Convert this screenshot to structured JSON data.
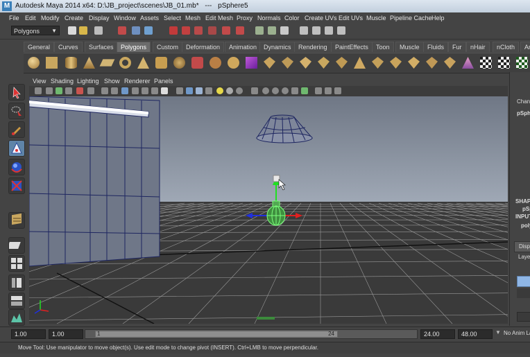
{
  "window": {
    "app_title": "Autodesk Maya 2014 x64: D:\\JB_project\\scenes\\JB_01.mb*",
    "separator": "---",
    "selection": "pSphere5"
  },
  "menubar": [
    "File",
    "Edit",
    "Modify",
    "Create",
    "Display",
    "Window",
    "Assets",
    "Select",
    "Mesh",
    "Edit Mesh",
    "Proxy",
    "Normals",
    "Color",
    "Create UVs",
    "Edit UVs",
    "Muscle",
    "Pipeline Cache",
    "Help"
  ],
  "status_line": {
    "mode": "Polygons"
  },
  "shelf": {
    "tabs": [
      "General",
      "Curves",
      "Surfaces",
      "Polygons",
      "Custom",
      "Deformation",
      "Animation",
      "Dynamics",
      "Rendering",
      "PaintEffects",
      "Toon",
      "Muscle",
      "Fluids",
      "Fur",
      "nHair",
      "nCloth",
      "An"
    ],
    "active_tab": "Polygons"
  },
  "viewport": {
    "menus": [
      "View",
      "Shading",
      "Lighting",
      "Show",
      "Renderer",
      "Panels"
    ]
  },
  "channel_box": {
    "title": "Chan",
    "object": "pSph",
    "shapes": "SHAP",
    "shape_name": "pSp",
    "inputs": "INPUT",
    "input_name": "poly",
    "display_tab": "Displ",
    "layers_tab": "Laye"
  },
  "timeline": {
    "start": "1.00",
    "playback_start": "1.00",
    "range_start": "1",
    "range_end": "24",
    "playback_end": "24.00",
    "end": "48.00",
    "anim_layer": "No Anim La"
  },
  "help_line": "Move Tool: Use manipulator to move object(s). Use edit mode to change pivot (INSERT). Ctrl+LMB to move perpendicular.",
  "colors": {
    "sky_top": "#6f7785",
    "sky_bottom": "#9fa8b5",
    "floor": "#3a3a3a",
    "wireframe": "#1e2660",
    "selected_wire": "#7cff7c",
    "axis_x": "#e02020",
    "axis_y": "#20e020",
    "axis_z": "#2030e0"
  }
}
